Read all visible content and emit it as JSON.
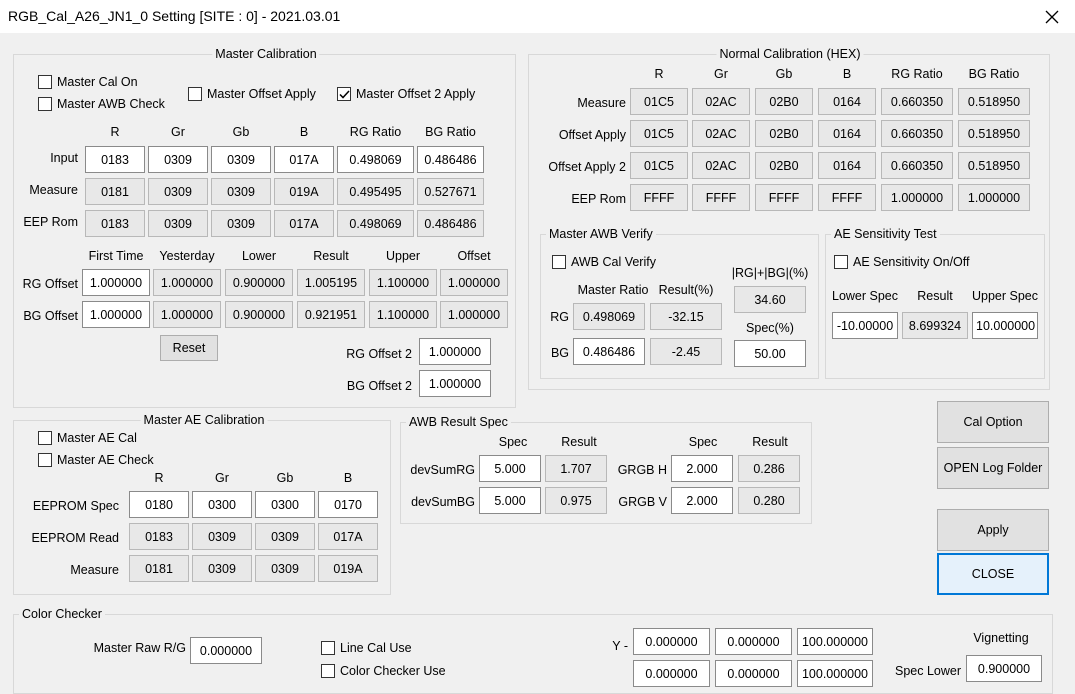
{
  "window": {
    "title": "RGB_Cal_A26_JN1_0 Setting [SITE : 0] - 2021.03.01"
  },
  "master_cal": {
    "title": "Master Calibration",
    "cb_master_cal_on": "Master Cal On",
    "cb_master_awb_check": "Master AWB Check",
    "cb_master_offset_apply": "Master Offset Apply",
    "cb_master_offset2_apply": "Master Offset 2 Apply",
    "cb_master_offset2_apply_checked": true,
    "cols": [
      "R",
      "Gr",
      "Gb",
      "B",
      "RG Ratio",
      "BG Ratio"
    ],
    "rows": [
      {
        "label": "Input",
        "values": [
          "0183",
          "0309",
          "0309",
          "017A",
          "0.498069",
          "0.486486"
        ]
      },
      {
        "label": "Measure",
        "values": [
          "0181",
          "0309",
          "0309",
          "019A",
          "0.495495",
          "0.527671"
        ]
      },
      {
        "label": "EEP Rom",
        "values": [
          "0183",
          "0309",
          "0309",
          "017A",
          "0.498069",
          "0.486486"
        ]
      }
    ],
    "offset_cols": [
      "First Time",
      "Yesterday",
      "Lower",
      "Result",
      "Upper",
      "Offset"
    ],
    "offset_rows": [
      {
        "label": "RG Offset",
        "values": [
          "1.000000",
          "1.000000",
          "0.900000",
          "1.005195",
          "1.100000",
          "1.000000"
        ]
      },
      {
        "label": "BG Offset",
        "values": [
          "1.000000",
          "1.000000",
          "0.900000",
          "0.921951",
          "1.100000",
          "1.000000"
        ]
      }
    ],
    "reset_label": "Reset",
    "rg_offset2_label": "RG Offset 2",
    "rg_offset2_value": "1.000000",
    "bg_offset2_label": "BG Offset 2",
    "bg_offset2_value": "1.000000"
  },
  "normal_cal": {
    "title": "Normal Calibration (HEX)",
    "cols": [
      "R",
      "Gr",
      "Gb",
      "B",
      "RG Ratio",
      "BG Ratio"
    ],
    "rows": [
      {
        "label": "Measure",
        "values": [
          "01C5",
          "02AC",
          "02B0",
          "0164",
          "0.660350",
          "0.518950"
        ]
      },
      {
        "label": "Offset Apply",
        "values": [
          "01C5",
          "02AC",
          "02B0",
          "0164",
          "0.660350",
          "0.518950"
        ]
      },
      {
        "label": "Offset Apply 2",
        "values": [
          "01C5",
          "02AC",
          "02B0",
          "0164",
          "0.660350",
          "0.518950"
        ]
      },
      {
        "label": "EEP Rom",
        "values": [
          "FFFF",
          "FFFF",
          "FFFF",
          "FFFF",
          "1.000000",
          "1.000000"
        ]
      }
    ]
  },
  "awb_verify": {
    "title": "Master AWB Verify",
    "cb_label": "AWB Cal Verify",
    "col_master_ratio": "Master Ratio",
    "col_result": "Result(%)",
    "sum_label": "|RG|+|BG|(%)",
    "sum_value": "34.60",
    "spec_label": "Spec(%)",
    "spec_value": "50.00",
    "rg": {
      "label": "RG",
      "ratio": "0.498069",
      "result": "-32.15"
    },
    "bg": {
      "label": "BG",
      "ratio": "0.486486",
      "result": "-2.45"
    }
  },
  "ae_sens": {
    "title": "AE Sensitivity Test",
    "cb_label": "AE Sensitivity On/Off",
    "cols": [
      "Lower Spec",
      "Result",
      "Upper Spec"
    ],
    "values": [
      "-10.00000",
      "8.699324",
      "10.000000"
    ]
  },
  "master_ae": {
    "title": "Master AE Calibration",
    "cb_ae_cal": "Master AE Cal",
    "cb_ae_check": "Master AE Check",
    "cols": [
      "R",
      "Gr",
      "Gb",
      "B"
    ],
    "rows": [
      {
        "label": "EEPROM Spec",
        "values": [
          "0180",
          "0300",
          "0300",
          "0170"
        ]
      },
      {
        "label": "EEPROM Read",
        "values": [
          "0183",
          "0309",
          "0309",
          "017A"
        ]
      },
      {
        "label": "Measure",
        "values": [
          "0181",
          "0309",
          "0309",
          "019A"
        ]
      }
    ]
  },
  "awb_spec": {
    "title": "AWB Result Spec",
    "col_spec": "Spec",
    "col_result": "Result",
    "rows_left": [
      {
        "label": "devSumRG",
        "spec": "5.000",
        "result": "1.707"
      },
      {
        "label": "devSumBG",
        "spec": "5.000",
        "result": "0.975"
      }
    ],
    "rows_right": [
      {
        "label": "GRGB H",
        "spec": "2.000",
        "result": "0.286"
      },
      {
        "label": "GRGB V",
        "spec": "2.000",
        "result": "0.280"
      }
    ]
  },
  "buttons": {
    "cal_option": "Cal Option",
    "open_log": "OPEN Log Folder",
    "apply": "Apply",
    "close": "CLOSE"
  },
  "color_checker": {
    "title": "Color Checker",
    "master_raw_label": "Master Raw R/G",
    "master_raw_value": "0.000000",
    "cb_line_cal": "Line Cal Use",
    "cb_color_checker": "Color Checker Use",
    "y_label": "Y -",
    "y_values": [
      "0.000000",
      "0.000000",
      "100.000000"
    ],
    "row2_values": [
      "0.000000",
      "0.000000",
      "100.000000"
    ],
    "vignetting_label": "Vignetting",
    "spec_lower_label": "Spec Lower",
    "spec_lower_value": "0.900000"
  }
}
